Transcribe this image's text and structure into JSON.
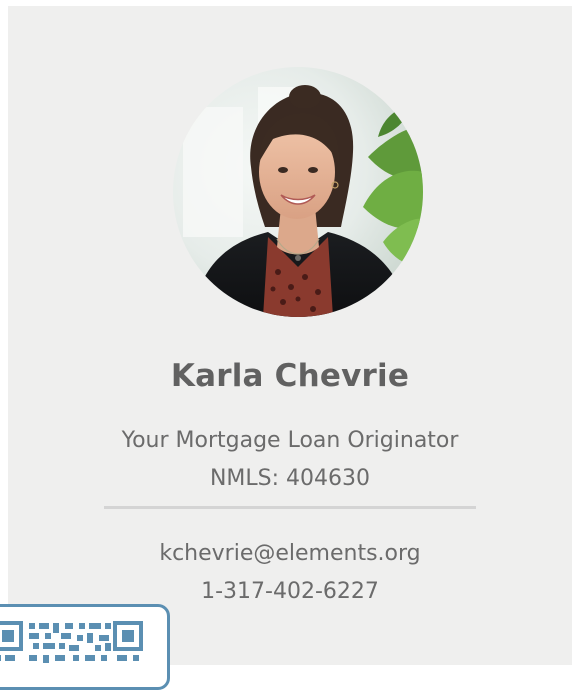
{
  "profile": {
    "name": "Karla Chevrie",
    "title": "Your Mortgage Loan Originator",
    "nmls": "NMLS: 404630",
    "email": "kchevrie@elements.org",
    "phone": "1-317-402-6227"
  },
  "icons": {
    "qr": "qr-code-icon"
  },
  "colors": {
    "card_bg": "#efefee",
    "name_text": "#616161",
    "body_text": "#6b6b6b",
    "divider": "#d4d4d4",
    "qr_accent": "#5b8fb2"
  }
}
